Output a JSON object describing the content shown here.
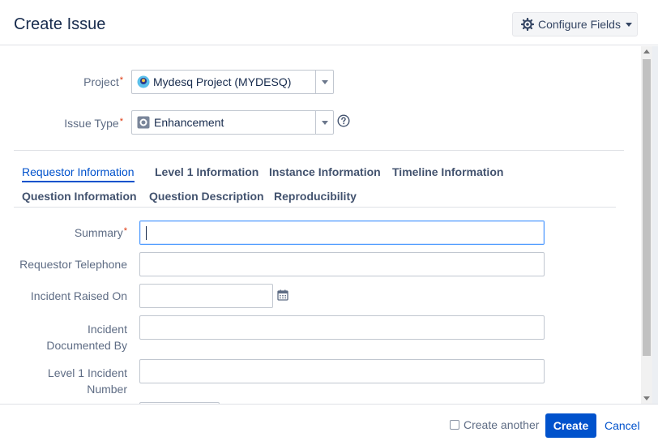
{
  "header": {
    "title": "Create Issue",
    "configure_label": "Configure Fields"
  },
  "fields": {
    "project": {
      "label": "Project",
      "required_mark": "*",
      "value": "Mydesq Project (MYDESQ)"
    },
    "issue_type": {
      "label": "Issue Type",
      "required_mark": "*",
      "value": "Enhancement"
    }
  },
  "tabs": [
    {
      "label": "Requestor Information"
    },
    {
      "label": "Level 1 Information"
    },
    {
      "label": "Instance Information"
    },
    {
      "label": "Timeline Information"
    },
    {
      "label": "Question Information"
    },
    {
      "label": "Question Description"
    },
    {
      "label": "Reproducibility"
    }
  ],
  "form": {
    "summary": {
      "label": "Summary",
      "required_mark": "*",
      "value": ""
    },
    "requestor_telephone": {
      "label": "Requestor Telephone",
      "value": ""
    },
    "incident_raised_on": {
      "label": "Incident Raised On",
      "value": ""
    },
    "incident_documented_by": {
      "label_line1": "Incident",
      "label_line2": "Documented By",
      "value": ""
    },
    "level1_incident_number": {
      "label_line1": "Level 1 Incident",
      "label_line2": "Number",
      "value": ""
    }
  },
  "footer": {
    "create_another_label": "Create another",
    "create_label": "Create",
    "cancel_label": "Cancel"
  },
  "colors": {
    "primary": "#0052cc",
    "required": "#de350b",
    "border": "#c1c7d0",
    "focus": "#4c9aff"
  }
}
